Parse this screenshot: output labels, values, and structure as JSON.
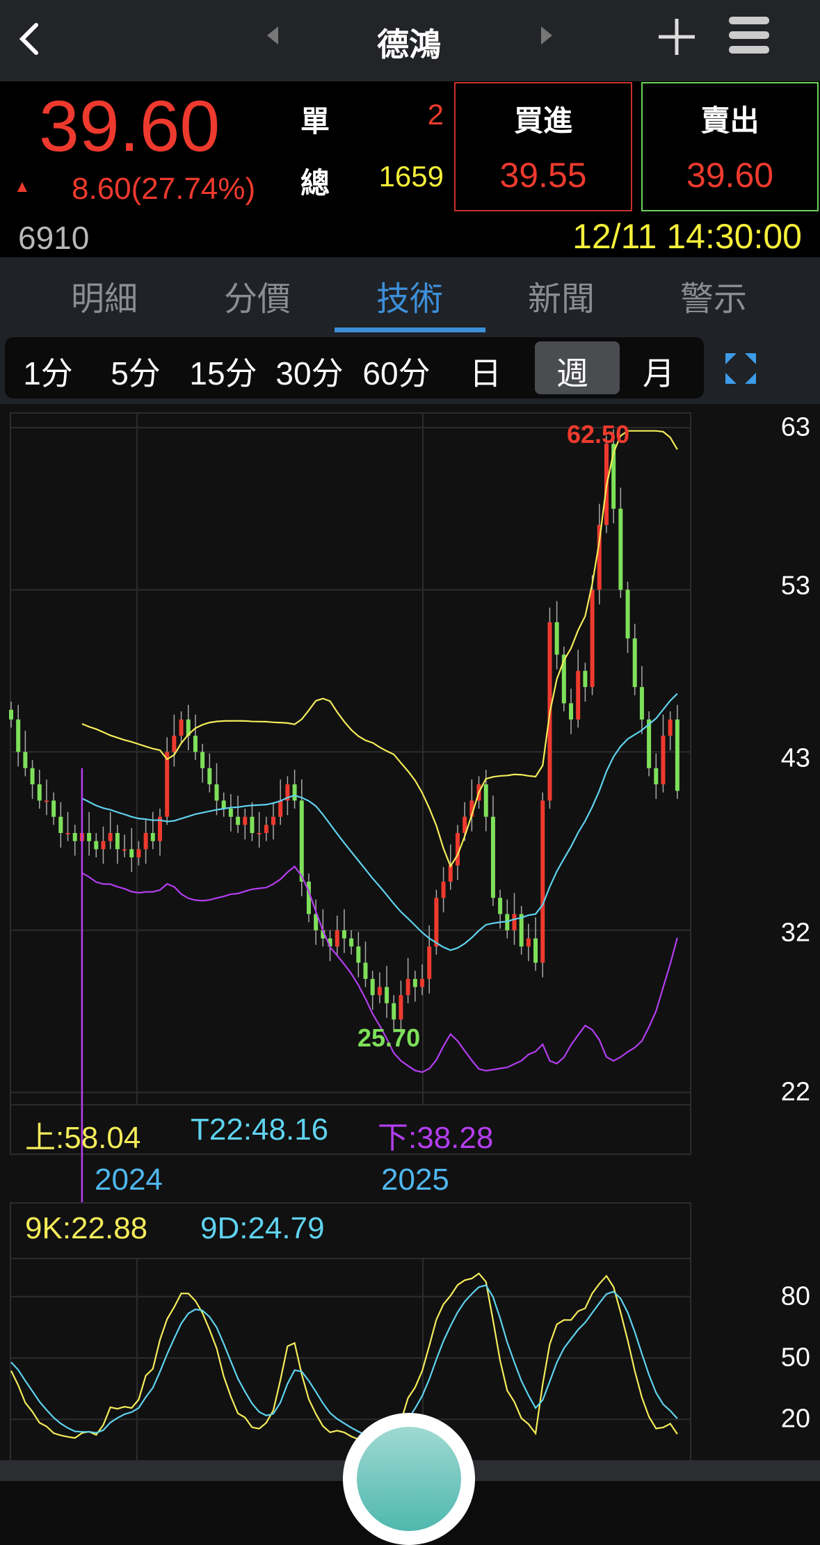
{
  "header": {
    "title": "德鴻",
    "back_icon": "chevron-left-icon",
    "prev_icon": "triangle-left-icon",
    "next_icon": "triangle-right-icon",
    "add_icon": "plus-icon",
    "menu_icon": "hamburger-icon"
  },
  "quote": {
    "price": "39.60",
    "change_arrow": "▲",
    "change": "8.60",
    "change_pct": "(27.74%)",
    "single_label": "單",
    "single_value": "2",
    "total_label": "總",
    "total_value": "1659",
    "bid_label": "買進",
    "bid_price": "39.55",
    "ask_label": "賣出",
    "ask_price": "39.60",
    "code": "6910",
    "datetime": "12/11 14:30:00"
  },
  "tabs": [
    {
      "label": "明細"
    },
    {
      "label": "分價"
    },
    {
      "label": "技術",
      "active": true
    },
    {
      "label": "新聞"
    },
    {
      "label": "警示"
    }
  ],
  "periods": [
    {
      "label": "1分"
    },
    {
      "label": "5分"
    },
    {
      "label": "15分"
    },
    {
      "label": "30分"
    },
    {
      "label": "60分"
    },
    {
      "label": "日"
    },
    {
      "label": "週",
      "selected": true
    },
    {
      "label": "月"
    }
  ],
  "colors": {
    "up": "#ee3a2e",
    "down": "#7ee05a",
    "upper": "#f5ec5a",
    "mid": "#5fd3ef",
    "lower": "#b43ef0",
    "k": "#f5ec5a",
    "d": "#5fd3ef",
    "accent": "#3d8fd8"
  },
  "chart_data": [
    {
      "type": "candlestick",
      "title": "Weekly K with Bollinger(22)",
      "y_ticks": [
        "63",
        "53",
        "43",
        "32",
        "22"
      ],
      "y_tick_values": [
        63,
        53,
        43,
        32,
        22
      ],
      "x_labels": [
        "2024",
        "2025"
      ],
      "x_label_index": [
        18,
        48
      ],
      "high_label": "62.50",
      "high_index": 84,
      "low_label": "25.70",
      "low_index": 54,
      "closes": [
        45,
        43,
        42,
        41,
        40,
        40,
        39,
        38,
        38,
        37.5,
        38,
        37.5,
        37,
        37.5,
        38,
        37,
        37,
        36.5,
        37,
        38,
        37.5,
        39,
        43,
        44,
        45,
        44,
        43,
        42,
        41,
        40,
        39.5,
        39,
        38.5,
        39,
        38,
        38,
        38.5,
        39,
        40,
        41,
        40,
        35,
        33,
        32,
        31.5,
        31,
        32,
        31.5,
        31,
        30,
        29,
        28,
        28.5,
        27.5,
        26.5,
        28,
        29,
        28.5,
        29,
        31,
        34,
        35,
        36,
        38,
        39,
        40,
        41,
        39,
        34,
        33,
        32,
        33,
        31,
        31.5,
        30,
        40,
        51,
        49,
        46,
        45,
        48,
        47,
        53,
        57,
        62,
        58,
        53,
        50,
        47,
        45,
        42,
        41,
        44,
        45,
        40.6
      ],
      "legend": {
        "upper": "上:58.04",
        "mid": "T22:48.16",
        "lower": "下:38.28"
      }
    },
    {
      "type": "line",
      "title": "KD(9)",
      "y_ticks": [
        "80",
        "50",
        "20"
      ],
      "y_tick_values": [
        80,
        50,
        20
      ],
      "legend": {
        "k": "9K:22.88",
        "d": "9D:24.79"
      }
    }
  ]
}
